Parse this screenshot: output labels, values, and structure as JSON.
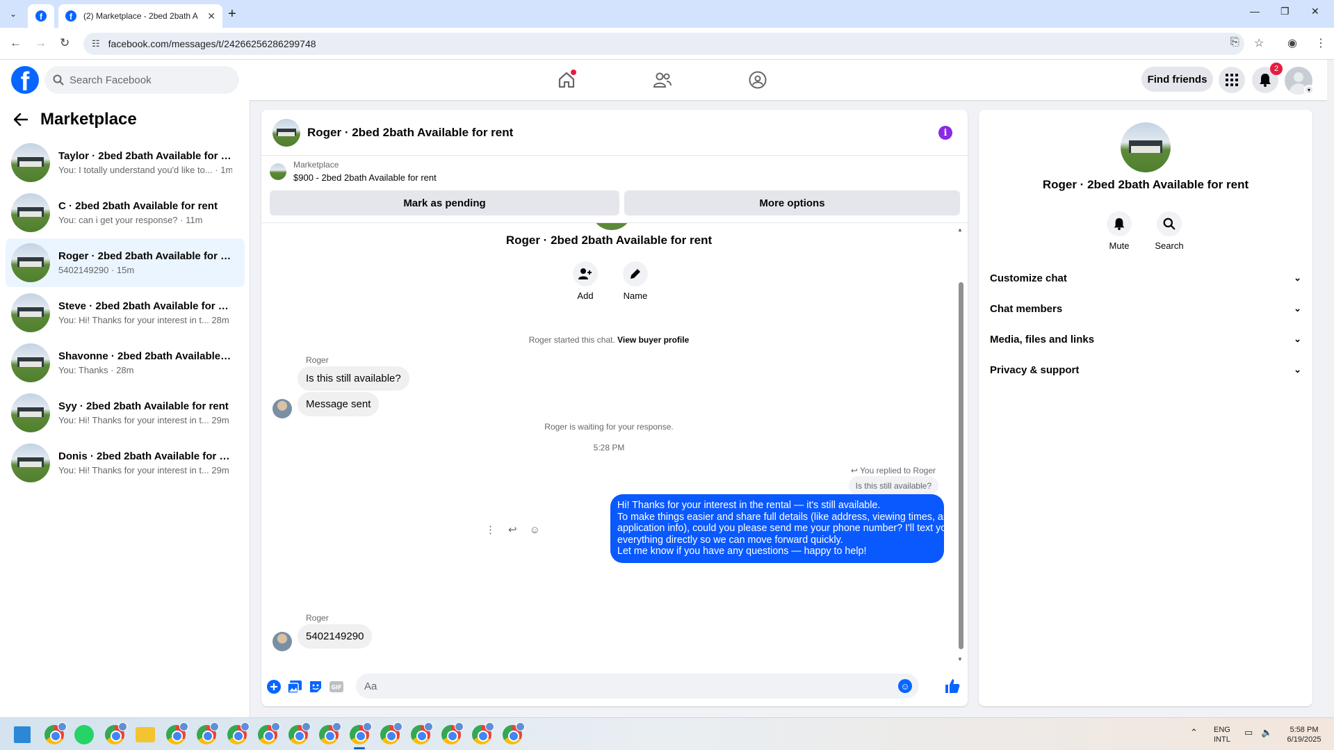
{
  "browser": {
    "tab_title": "(2) Marketplace - 2bed 2bath A",
    "url": "facebook.com/messages/t/24266256286299748"
  },
  "fb": {
    "search_placeholder": "Search Facebook",
    "find_friends": "Find friends",
    "notification_count": "2"
  },
  "sidebar": {
    "title": "Marketplace",
    "conversations": [
      {
        "name": "Taylor · 2bed 2bath Available for r...",
        "preview": "You: I totally understand you'd like to... · 1m"
      },
      {
        "name": "C · 2bed 2bath Available for rent",
        "preview": "You: can i get your response? · 11m"
      },
      {
        "name": "Roger · 2bed 2bath Available for r...",
        "preview": "5402149290 · 15m"
      },
      {
        "name": "Steve · 2bed 2bath Available for rent",
        "preview": "You: Hi! Thanks for your interest in t...  28m"
      },
      {
        "name": "Shavonne · 2bed 2bath Available f...",
        "preview": "You: Thanks · 28m"
      },
      {
        "name": "Syy · 2bed 2bath Available for rent",
        "preview": "You: Hi! Thanks for your interest in t...  29m"
      },
      {
        "name": "Donis · 2bed 2bath Available for re...",
        "preview": "You: Hi! Thanks for your interest in t...  29m"
      }
    ]
  },
  "chat": {
    "header_title": "Roger · 2bed 2bath Available for rent",
    "marketplace_label": "Marketplace",
    "listing": "$900 - 2bed 2bath Available for rent",
    "mark_pending": "Mark as pending",
    "more_options": "More options",
    "convo_title": "Roger · 2bed 2bath Available for rent",
    "add_label": "Add",
    "name_label": "Name",
    "started_text": "Roger started this chat.",
    "view_profile": "View buyer profile",
    "sender1": "Roger",
    "msg1": "Is this still available?",
    "msg2": "Message sent",
    "waiting": "Roger is waiting for your response.",
    "time": "5:28 PM",
    "replied_to": "You replied to Roger",
    "quoted": "Is this still available?",
    "out_lines": [
      "Hi! Thanks for your interest in the rental — it's still available.",
      "To make things easier and share full details (like address, viewing times, and",
      "application info), could you please send me your phone number? I'll text you",
      "everything directly so we can move forward quickly.",
      "Let me know if you have any questions — happy to help!"
    ],
    "sender2": "Roger",
    "msg3": "5402149290",
    "composer_placeholder": "Aa"
  },
  "info": {
    "title": "Roger · 2bed 2bath Available for rent",
    "mute": "Mute",
    "search": "Search",
    "rows": [
      "Customize chat",
      "Chat members",
      "Media, files and links",
      "Privacy & support"
    ]
  },
  "taskbar": {
    "lang1": "ENG",
    "lang2": "INTL",
    "clock_time": "5:58 PM",
    "clock_date": "6/19/2025"
  },
  "colors": {
    "accent": "#0866ff",
    "bubble_out": "#0a59ff",
    "info_icon": "#8a2be2"
  }
}
